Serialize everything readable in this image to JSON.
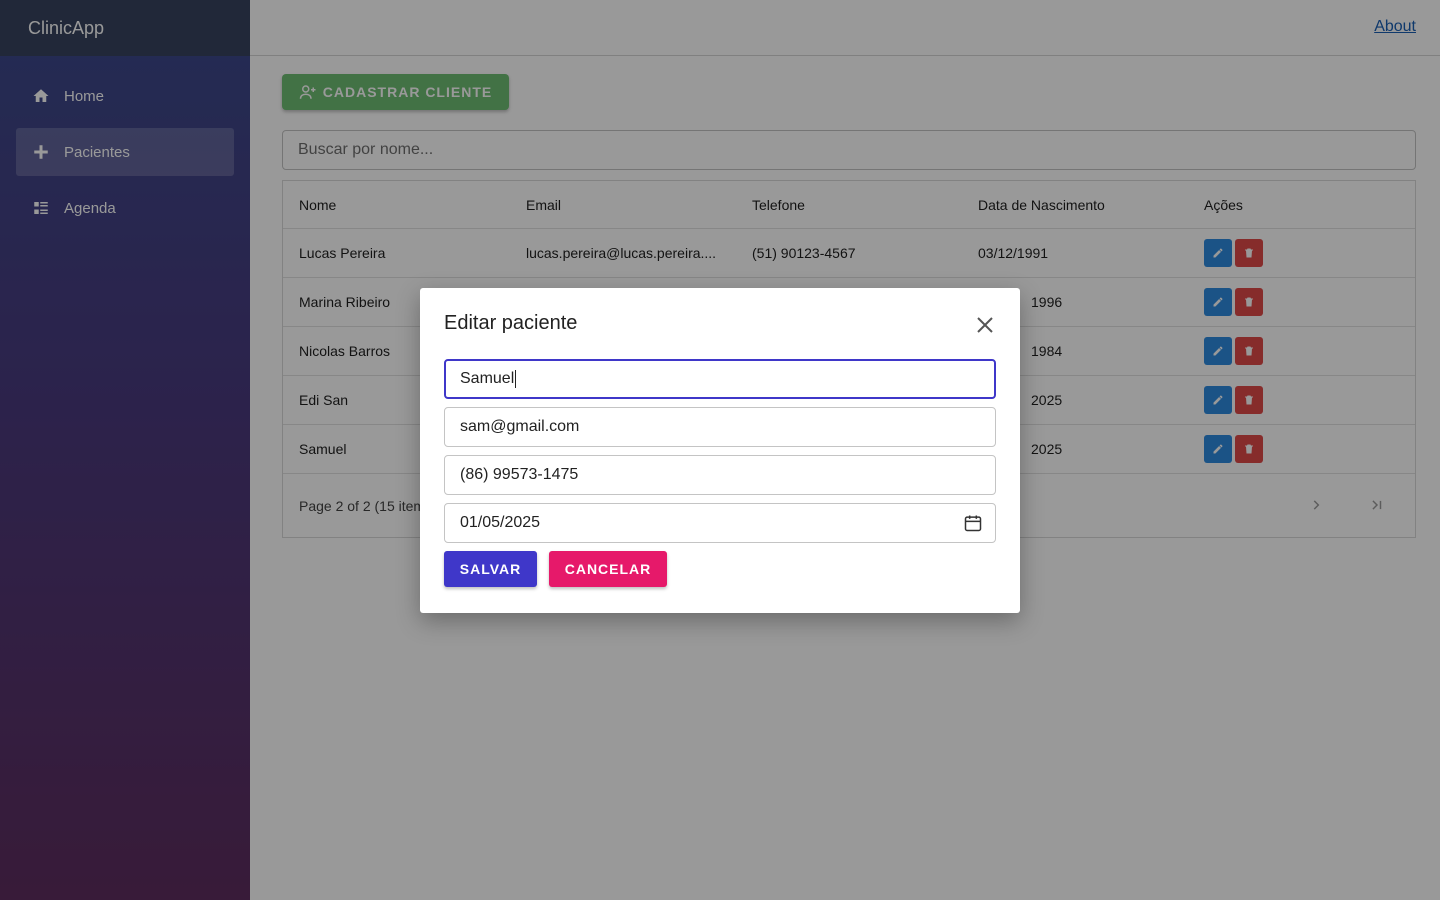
{
  "app": {
    "title": "ClinicApp"
  },
  "header": {
    "about_label": "About"
  },
  "sidebar": {
    "items": [
      {
        "label": "Home",
        "icon": "home-icon"
      },
      {
        "label": "Pacientes",
        "icon": "plus-icon",
        "active": true
      },
      {
        "label": "Agenda",
        "icon": "list-icon"
      }
    ]
  },
  "main": {
    "add_button_label": "CADASTRAR CLIENTE",
    "search_placeholder": "Buscar por nome...",
    "columns": [
      "Nome",
      "Email",
      "Telefone",
      "Data de Nascimento",
      "Ações"
    ],
    "rows": [
      {
        "nome": "Lucas Pereira",
        "email": "lucas.pereira@lucas.pereira....",
        "telefone": "(51) 90123-4567",
        "nascimento": "03/12/1991"
      },
      {
        "nome": "Marina Ribeiro",
        "email": "",
        "telefone": "",
        "nascimento": "1996"
      },
      {
        "nome": "Nicolas Barros",
        "email": "",
        "telefone": "",
        "nascimento": "1984"
      },
      {
        "nome": "Edi San",
        "email": "",
        "telefone": "",
        "nascimento": "2025"
      },
      {
        "nome": "Samuel",
        "email": "",
        "telefone": "",
        "nascimento": "2025"
      }
    ],
    "pagination_text": "Page 2 of 2 (15 item"
  },
  "modal": {
    "title": "Editar paciente",
    "nome_value": "Samuel",
    "email_value": "sam@gmail.com",
    "telefone_value": "(86) 99573-1475",
    "nascimento_value": "01/05/2025",
    "save_label": "SALVAR",
    "cancel_label": "CANCELAR"
  },
  "colors": {
    "primary": "#3f37c9",
    "danger_accent": "#e6196a",
    "add_button": "#6fbf73",
    "edit_button": "#2d8ae0",
    "delete_button": "#e04a48"
  }
}
